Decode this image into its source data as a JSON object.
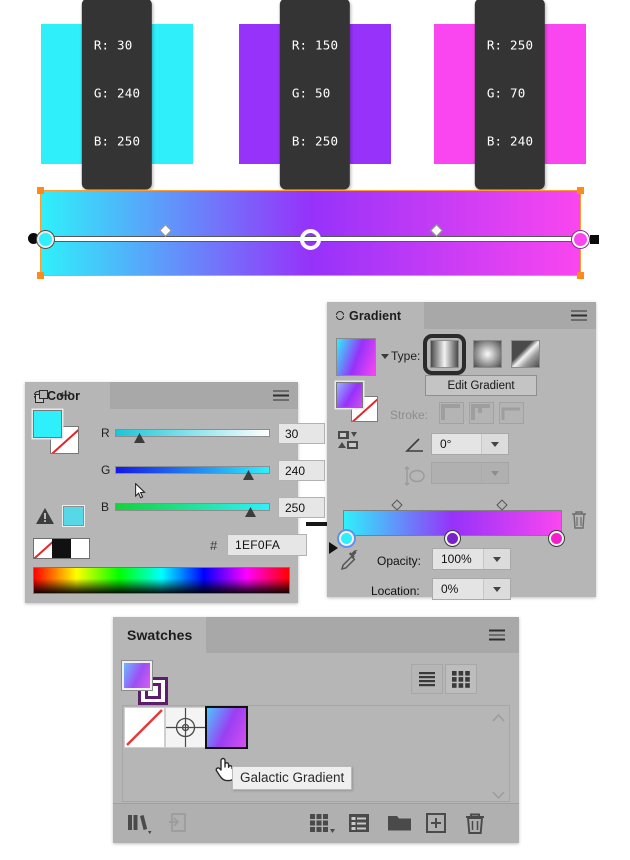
{
  "artwork": {
    "swatch_label": "rgb-color-sample",
    "squares": [
      {
        "name": "cyan-square",
        "color": "#2ff0fa",
        "r_label": "R: 30",
        "g_label": "G: 240",
        "b_label": "B: 250"
      },
      {
        "name": "purple-square",
        "color": "#9632fa",
        "r_label": "R: 150",
        "g_label": "G: 50",
        "b_label": "B: 250"
      },
      {
        "name": "magenta-square",
        "color": "#fa46f0",
        "r_label": "R: 250",
        "g_label": "G: 70",
        "b_label": "B: 240"
      }
    ],
    "gradient_object": {
      "name": "galactic-gradient-rectangle",
      "stops": [
        {
          "color": "#2ff0fa",
          "location": 0
        },
        {
          "color": "#9632fa",
          "location": 50
        },
        {
          "color": "#fa46f0",
          "location": 100
        }
      ],
      "midpoints": [
        25,
        75
      ],
      "angle_label": "0°"
    }
  },
  "color_panel": {
    "tab_title": "Color",
    "menu_icon": "hamburger-icon",
    "swap_icon": "swap-fill-stroke-icon",
    "revert_icon": "revert-arrow-icon",
    "fill_color": "#2ff0fa",
    "stroke_color": "none",
    "out_of_gamut_icon": "out-of-gamut-warning-icon",
    "out_of_gamut_color": "#56d8e6",
    "none_black_white": [
      "none",
      "black",
      "white"
    ],
    "channels": [
      {
        "label": "R",
        "value": "30",
        "track_from": "#1ac6d8",
        "track_to": "#ffffff",
        "thumb_pct": 12
      },
      {
        "label": "G",
        "value": "240",
        "track_from": "#1417e8",
        "track_to": "#2ff0fa",
        "thumb_pct": 94
      },
      {
        "label": "B",
        "value": "250",
        "track_from": "#12d43a",
        "track_to": "#2ff0fa",
        "thumb_pct": 98
      }
    ],
    "hex_symbol": "#",
    "hex_value": "1EF0FA",
    "spectrum_icon": "color-spectrum-ramp"
  },
  "gradient_panel": {
    "tab_title": "Gradient",
    "menu_icon": "hamburger-icon",
    "preview_icon": "gradient-preview-swatch",
    "preview_caret_icon": "chevron-down-icon",
    "type_label": "Type:",
    "type_options": [
      "linear-gradient",
      "radial-gradient",
      "freeform-gradient"
    ],
    "type_selected": "linear-gradient",
    "edit_gradient_label": "Edit Gradient",
    "stroke_label": "Stroke:",
    "stroke_options": [
      "stroke-within",
      "stroke-along",
      "stroke-across"
    ],
    "angle_icon": "gradient-angle-icon",
    "angle_value": "0°",
    "aspect_icon": "gradient-aspect-ratio-icon",
    "aspect_value": "",
    "delete_icon": "trash-icon",
    "eyedropper_icon": "eyedropper-icon",
    "opacity_label": "Opacity:",
    "opacity_value": "100%",
    "location_label": "Location:",
    "location_value": "0%",
    "slider_stops": [
      {
        "color": "#2ff0fa",
        "location": 0,
        "selected": true
      },
      {
        "color": "#9632fa",
        "location": 50,
        "selected": false
      },
      {
        "color": "#fa46f0",
        "location": 100,
        "selected": false
      }
    ],
    "slider_midpoints": [
      25,
      75
    ]
  },
  "swatches_panel": {
    "tab_title": "Swatches",
    "menu_icon": "hamburger-icon",
    "fill_preview_icon": "gradient-fill-preview",
    "stroke_preview_icon": "stroke-preview",
    "view_list_icon": "list-view-icon",
    "view_grid_icon": "grid-view-icon",
    "view_selected": "grid-view-icon",
    "swatches": [
      {
        "name": "none-swatch",
        "type": "none"
      },
      {
        "name": "registration-swatch",
        "type": "registration"
      },
      {
        "name": "galactic-gradient-swatch",
        "type": "gradient",
        "selected": true
      }
    ],
    "tooltip_text": "Galactic Gradient",
    "cursor_icon": "hand-pointer-cursor",
    "scroll_up_icon": "chevron-up-icon",
    "scroll_down_icon": "chevron-down-icon",
    "footer_buttons": [
      {
        "name": "swatch-libraries-button",
        "icon": "books-icon",
        "has_caret": true
      },
      {
        "name": "add-to-library-button",
        "icon": "library-add-icon",
        "has_caret": false
      },
      {
        "name": "show-swatch-kinds-button",
        "icon": "swatch-kinds-icon",
        "has_caret": true
      },
      {
        "name": "swatch-options-button",
        "icon": "options-list-icon",
        "has_caret": false
      },
      {
        "name": "new-color-group-button",
        "icon": "folder-icon",
        "has_caret": false
      },
      {
        "name": "new-swatch-button",
        "icon": "plus-box-icon",
        "has_caret": false
      },
      {
        "name": "delete-swatch-button",
        "icon": "trash-icon",
        "has_caret": false
      }
    ]
  }
}
